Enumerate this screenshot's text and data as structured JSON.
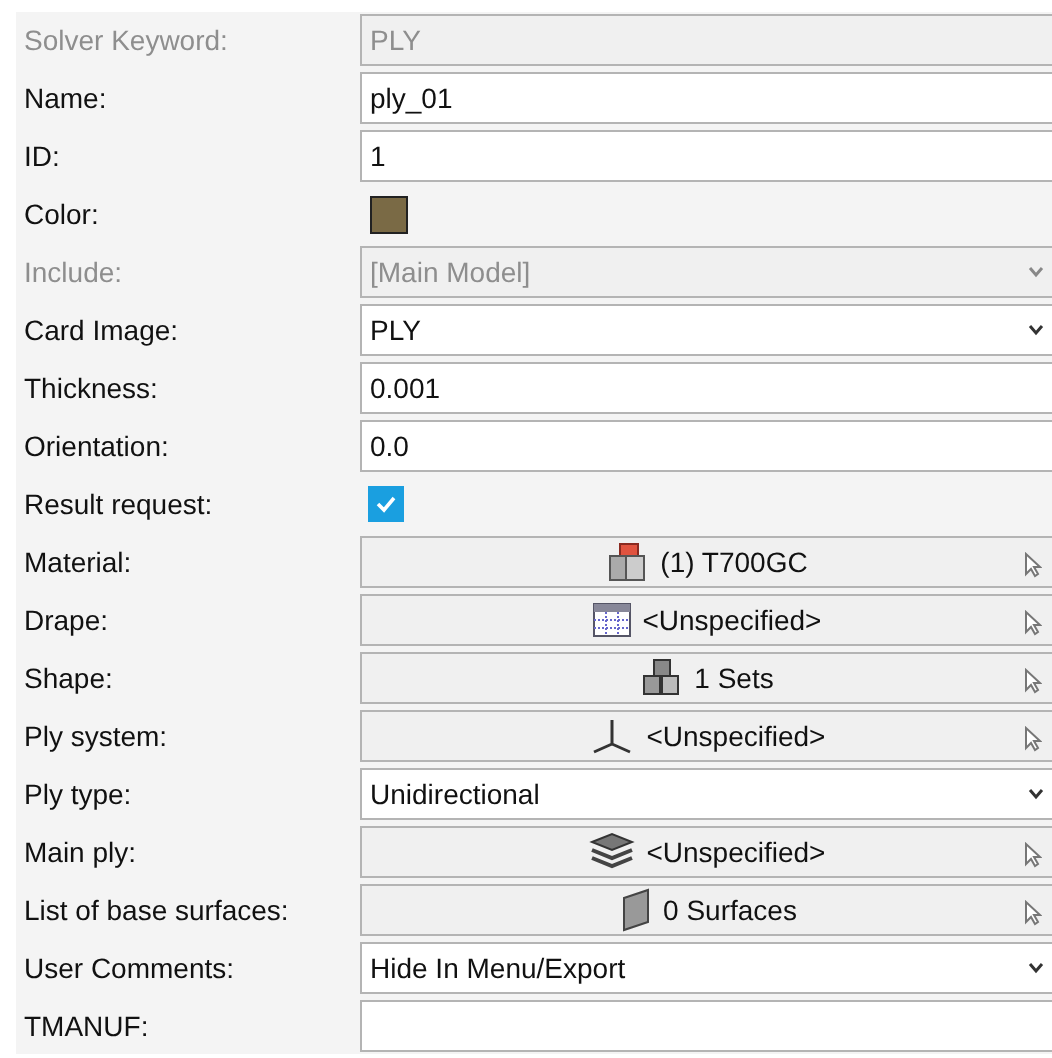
{
  "fields": [
    {
      "label": "Solver Keyword:",
      "kind": "text",
      "value": "PLY",
      "disabled": true
    },
    {
      "label": "Name:",
      "kind": "text",
      "value": "ply_01",
      "disabled": false
    },
    {
      "label": "ID:",
      "kind": "text",
      "value": "1",
      "disabled": false
    },
    {
      "label": "Color:",
      "kind": "color",
      "color": "#7a6a45",
      "disabled": false
    },
    {
      "label": "Include:",
      "kind": "select",
      "value": "[Main Model]",
      "disabled": true
    },
    {
      "label": "Card Image:",
      "kind": "select",
      "value": "PLY",
      "disabled": false
    },
    {
      "label": "Thickness:",
      "kind": "text",
      "value": "0.001",
      "disabled": false
    },
    {
      "label": "Orientation:",
      "kind": "text",
      "value": "0.0",
      "disabled": false
    },
    {
      "label": "Result request:",
      "kind": "checkbox",
      "checked": true,
      "disabled": false
    },
    {
      "label": "Material:",
      "kind": "entity",
      "value": "(1) T700GC",
      "disabled": false
    },
    {
      "label": "Drape:",
      "kind": "entity",
      "value": "<Unspecified>",
      "disabled": false
    },
    {
      "label": "Shape:",
      "kind": "entity",
      "value": "1 Sets",
      "disabled": false
    },
    {
      "label": "Ply system:",
      "kind": "entity",
      "value": "<Unspecified>",
      "disabled": false
    },
    {
      "label": "Ply type:",
      "kind": "select",
      "value": "Unidirectional",
      "disabled": false
    },
    {
      "label": "Main ply:",
      "kind": "entity",
      "value": "<Unspecified>",
      "disabled": false
    },
    {
      "label": "List of base surfaces:",
      "kind": "entity",
      "value": "0 Surfaces",
      "disabled": false
    },
    {
      "label": "User Comments:",
      "kind": "select",
      "value": "Hide In Menu/Export",
      "disabled": false
    },
    {
      "label": "TMANUF:",
      "kind": "text",
      "disabled": false
    }
  ]
}
